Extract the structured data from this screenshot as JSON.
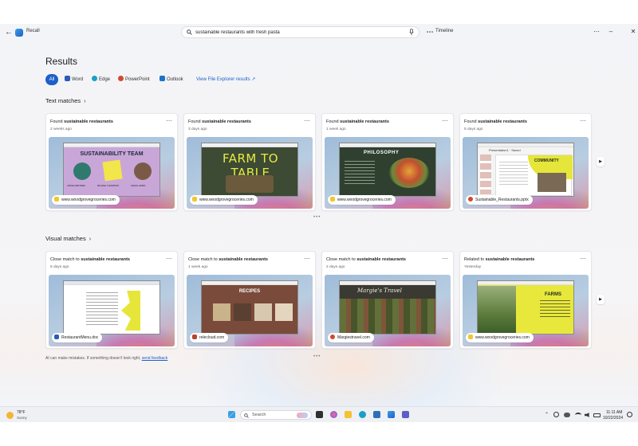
{
  "app": {
    "name": "Recall"
  },
  "search": {
    "value": "sustainable restaurants with fresh pasta",
    "placeholder": ""
  },
  "timeline_label": "Timeline",
  "results_title": "Results",
  "filters": {
    "all": "All",
    "items": [
      "Word",
      "Edge",
      "PowerPoint",
      "Outlook"
    ],
    "file_explorer_link": "View File Explorer results"
  },
  "text_matches": {
    "title": "Text matches",
    "cards": [
      {
        "prefix": "Found",
        "bold": "sustainable restaurants",
        "time": "2 weeks ago",
        "source": "www.woodgrovegroceries.com",
        "thumb_heading": "SUSTAINABILITY TEAM",
        "names": [
          "JORGE MARTINEZ",
          "MICHAEL THOMPSON",
          "SARAH JAMES"
        ]
      },
      {
        "prefix": "Found",
        "bold": "sustainable restaurants",
        "time": "3 days ago",
        "source": "www.woodgrovegroceries.com",
        "thumb_heading": "FARM TO TABLE"
      },
      {
        "prefix": "Found",
        "bold": "sustainable restaurants",
        "time": "1 week ago",
        "source": "www.woodgrovegroceries.com",
        "thumb_heading": "PHILOSOPHY"
      },
      {
        "prefix": "Found",
        "bold": "sustainable restaurants",
        "time": "5 days ago",
        "source": "Sustainable_Restaurants.pptx",
        "thumb_heading": "COMMUNITY",
        "thumb_title": "Presentation1 · Saved"
      }
    ]
  },
  "visual_matches": {
    "title": "Visual matches",
    "cards": [
      {
        "prefix": "Close match to",
        "bold": "sustainable restaurants",
        "time": "6 days ago",
        "source": "RestaurantMenu.doc"
      },
      {
        "prefix": "Close match to",
        "bold": "sustainable restaurants",
        "time": "1 week ago",
        "source": "relecloud.com",
        "thumb_heading": "RECIPES"
      },
      {
        "prefix": "Close match to",
        "bold": "sustainable restaurants",
        "time": "2 days ago",
        "source": "Margiestravel.com",
        "thumb_heading": "Margie's Travel"
      },
      {
        "prefix": "Related to",
        "bold": "sustainable restaurants",
        "time": "Yesterday",
        "source": "www.woodgrovegroceries.com",
        "thumb_heading": "FARMS"
      }
    ]
  },
  "disclaimer": {
    "text": "AI can make mistakes. If something doesn't look right, ",
    "link": "send feedback"
  },
  "taskbar": {
    "weather_temp": "78°F",
    "weather_cond": "Sunny",
    "search_label": "Search",
    "time": "11:11 AM",
    "date": "10/22/2024"
  },
  "colors": {
    "accent": "#1e5fc9"
  }
}
